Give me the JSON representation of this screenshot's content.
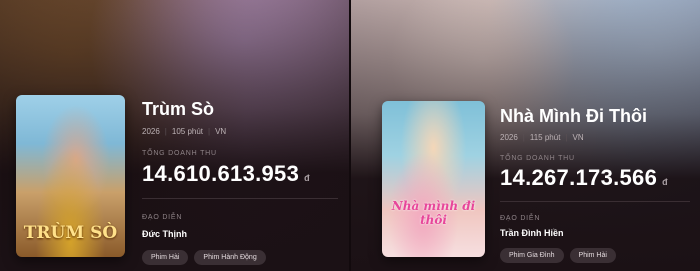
{
  "movies": [
    {
      "title": "Trùm Sò",
      "year": "2026",
      "duration": "105 phút",
      "country": "VN",
      "revenue_label": "TỔNG DOANH THU",
      "revenue": "14.610.613.953",
      "currency": "đ",
      "director_label": "ĐẠO DIỄN",
      "director": "Đức Thịnh",
      "genres": [
        "Phim Hài",
        "Phim Hành Động"
      ],
      "poster_text": "TRÙM SÒ"
    },
    {
      "title": "Nhà Mình Đi Thôi",
      "year": "2026",
      "duration": "115 phút",
      "country": "VN",
      "revenue_label": "TỔNG DOANH THU",
      "revenue": "14.267.173.566",
      "currency": "đ",
      "director_label": "ĐẠO DIỄN",
      "director": "Trần Đình Hiền",
      "genres": [
        "Phim Gia Đình",
        "Phim Hài"
      ],
      "poster_text": "Nhà mình đi thôi"
    }
  ]
}
